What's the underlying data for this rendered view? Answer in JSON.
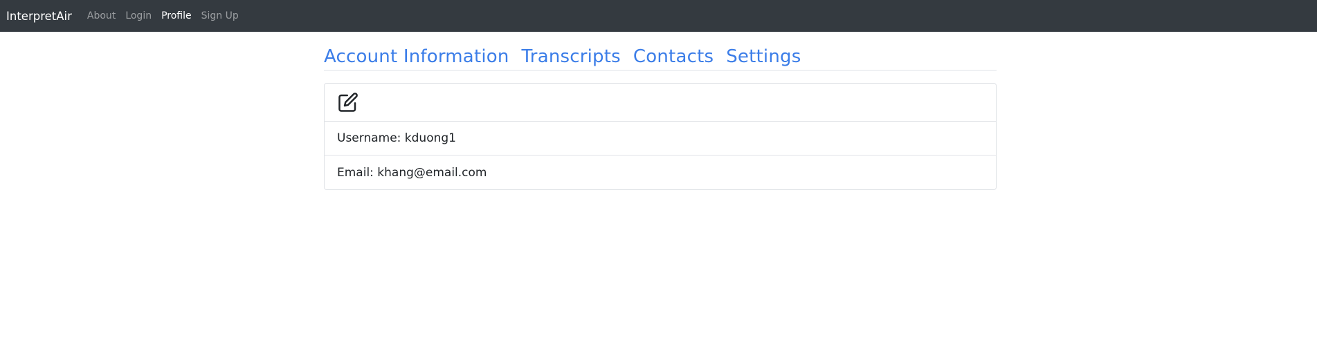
{
  "navbar": {
    "brand": "InterpretAir",
    "links": [
      "About",
      "Login",
      "Profile",
      "Sign Up"
    ],
    "active": "Profile"
  },
  "tabs": [
    "Account Information",
    "Transcripts",
    "Contacts",
    "Settings"
  ],
  "account": {
    "edit_icon": "edit-icon",
    "username_line": "Username: kduong1",
    "email_line": "Email: khang@email.com"
  },
  "colors": {
    "navbar_bg": "#343a40",
    "tab_link": "#3b7de8",
    "border": "#dee2e6"
  }
}
